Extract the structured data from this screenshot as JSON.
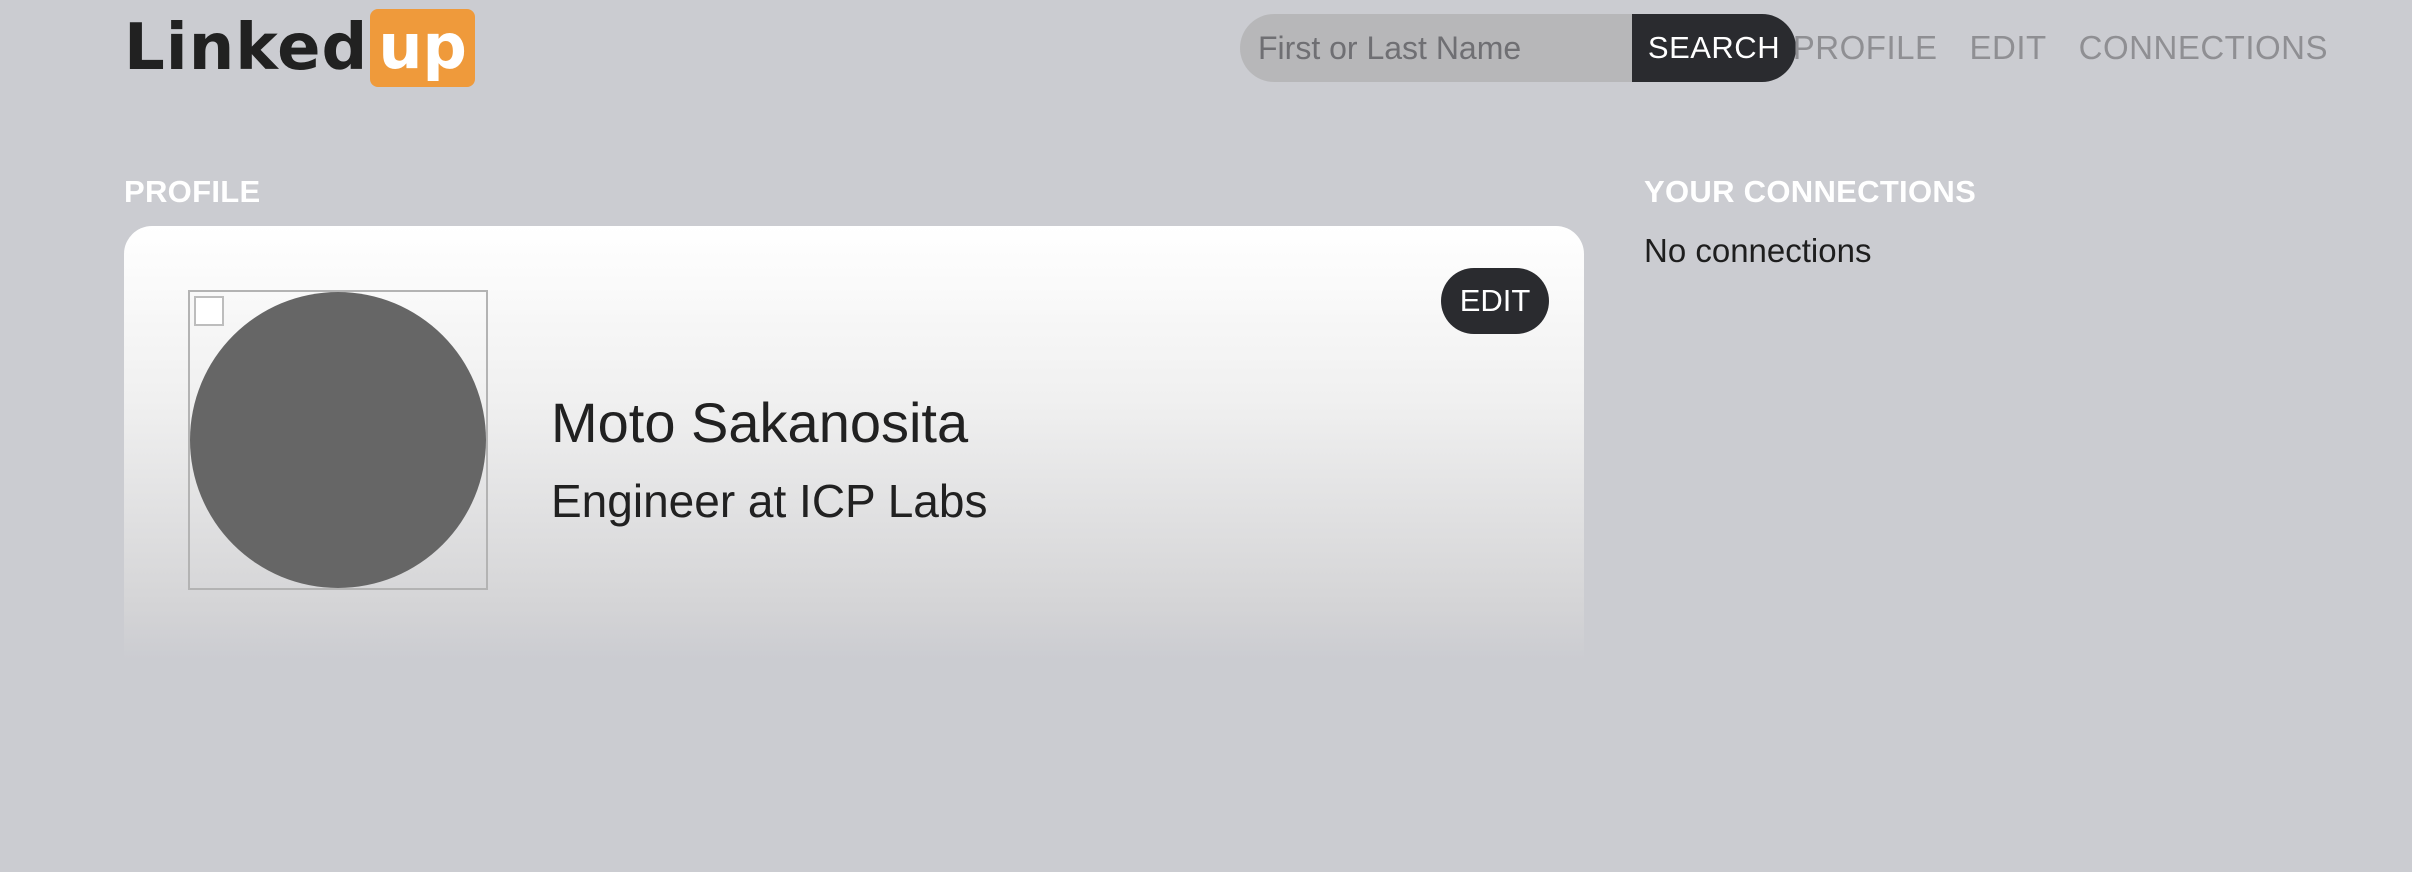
{
  "brand": {
    "name_part1": "Linked",
    "name_part2": "up",
    "accent_color": "#ef9a3b"
  },
  "search": {
    "placeholder": "First or Last Name",
    "value": "",
    "button_label": "SEARCH"
  },
  "nav": {
    "items": [
      {
        "label": "PROFILE"
      },
      {
        "label": "EDIT"
      },
      {
        "label": "CONNECTIONS"
      }
    ]
  },
  "profile_section": {
    "heading": "PROFILE",
    "name": "Moto Sakanosita",
    "title": "Engineer at ICP Labs",
    "edit_label": "EDIT",
    "avatar_icon": "broken-image-icon"
  },
  "connections_section": {
    "heading": "YOUR CONNECTIONS",
    "empty_text": "No connections"
  },
  "colors": {
    "background": "#cbccd1",
    "dark_button": "#2a2b2f",
    "avatar_placeholder": "#666666"
  }
}
